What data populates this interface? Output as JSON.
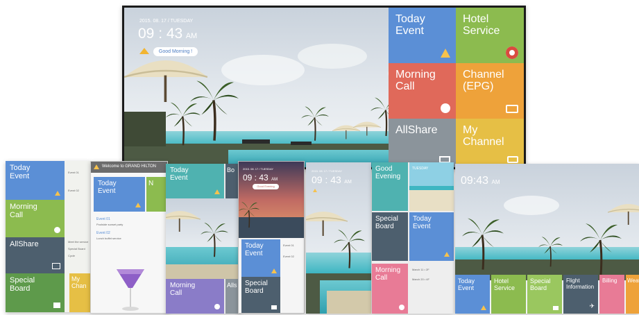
{
  "colors": {
    "blue": "#5b8fd6",
    "green": "#8cbb4f",
    "coral": "#e0695a",
    "orange": "#eea23a",
    "gray": "#8b949b",
    "yellow": "#e6bf45",
    "teal": "#4fb2b0",
    "slate": "#4d5f6e",
    "purple": "#8a7cc8",
    "pink": "#e87b96"
  },
  "main_tv": {
    "date": "2015. 08. 17 / TUESDAY",
    "time": "09 : 43",
    "ampm": "AM",
    "greeting": "Good Morning !",
    "tiles": [
      {
        "label": "Today\nEvent",
        "icon": "party-hat-icon"
      },
      {
        "label": "Hotel\nService",
        "icon": "bellhop-icon"
      },
      {
        "label": "Morning\nCall",
        "icon": "clock-icon"
      },
      {
        "label": "Channel\n(EPG)",
        "icon": "tv-icon"
      },
      {
        "label": "AllShare",
        "icon": "share-icon"
      },
      {
        "label": "My\nChannel",
        "icon": "tv-icon"
      }
    ]
  },
  "screen1": {
    "tiles": [
      "Today\nEvent",
      "Morning\nCall",
      "AllShare",
      "Special\nBoard"
    ],
    "side_texts": [
      "Event 01",
      "Event 02",
      "Meet the service",
      "Special Board",
      "Cycle"
    ],
    "my_channel": "My\nChan"
  },
  "screen2": {
    "welcome": "Welcome to GRAND HILTON",
    "today_event": "Today\nEvent",
    "event1_title": "Event 01",
    "event1_desc": "Poolside sunset party",
    "event2_title": "Event 02",
    "event2_desc": "Lunch buffet service",
    "side_word": "N"
  },
  "screen3": {
    "today_event": "Today\nEvent",
    "board": "Bo",
    "morning_call": "Morning\nCall",
    "allshare": "Alls"
  },
  "screen4": {
    "date": "2015. 08. 17 / TUESDAY",
    "time": "09 : 43",
    "ampm": "AM",
    "greeting": "Good Evening",
    "today_event": "Today\nEvent",
    "special_board": "Special\nBoard",
    "event1": "Event 01",
    "event2": "Event 02"
  },
  "screen5": {
    "date": "2015. 08. 17 / TUESDAY",
    "time": "09 : 43",
    "ampm": "AM"
  },
  "screen6": {
    "good_evening": "Good\nEvening",
    "tuesday": "TUESDAY",
    "special_board": "Special\nBoard",
    "today_event": "Today\nEvent",
    "morning_call": "Morning\nCall",
    "march1": "March 11 • 2F",
    "march2": "March 20 • 4F"
  },
  "screen7": {
    "time": "09:43",
    "ampm": "AM",
    "tiles": [
      "Today\nEvent",
      "Hotel\nService",
      "Special\nBoard",
      "Flight\nInformation",
      "Billing",
      "Weather"
    ]
  }
}
